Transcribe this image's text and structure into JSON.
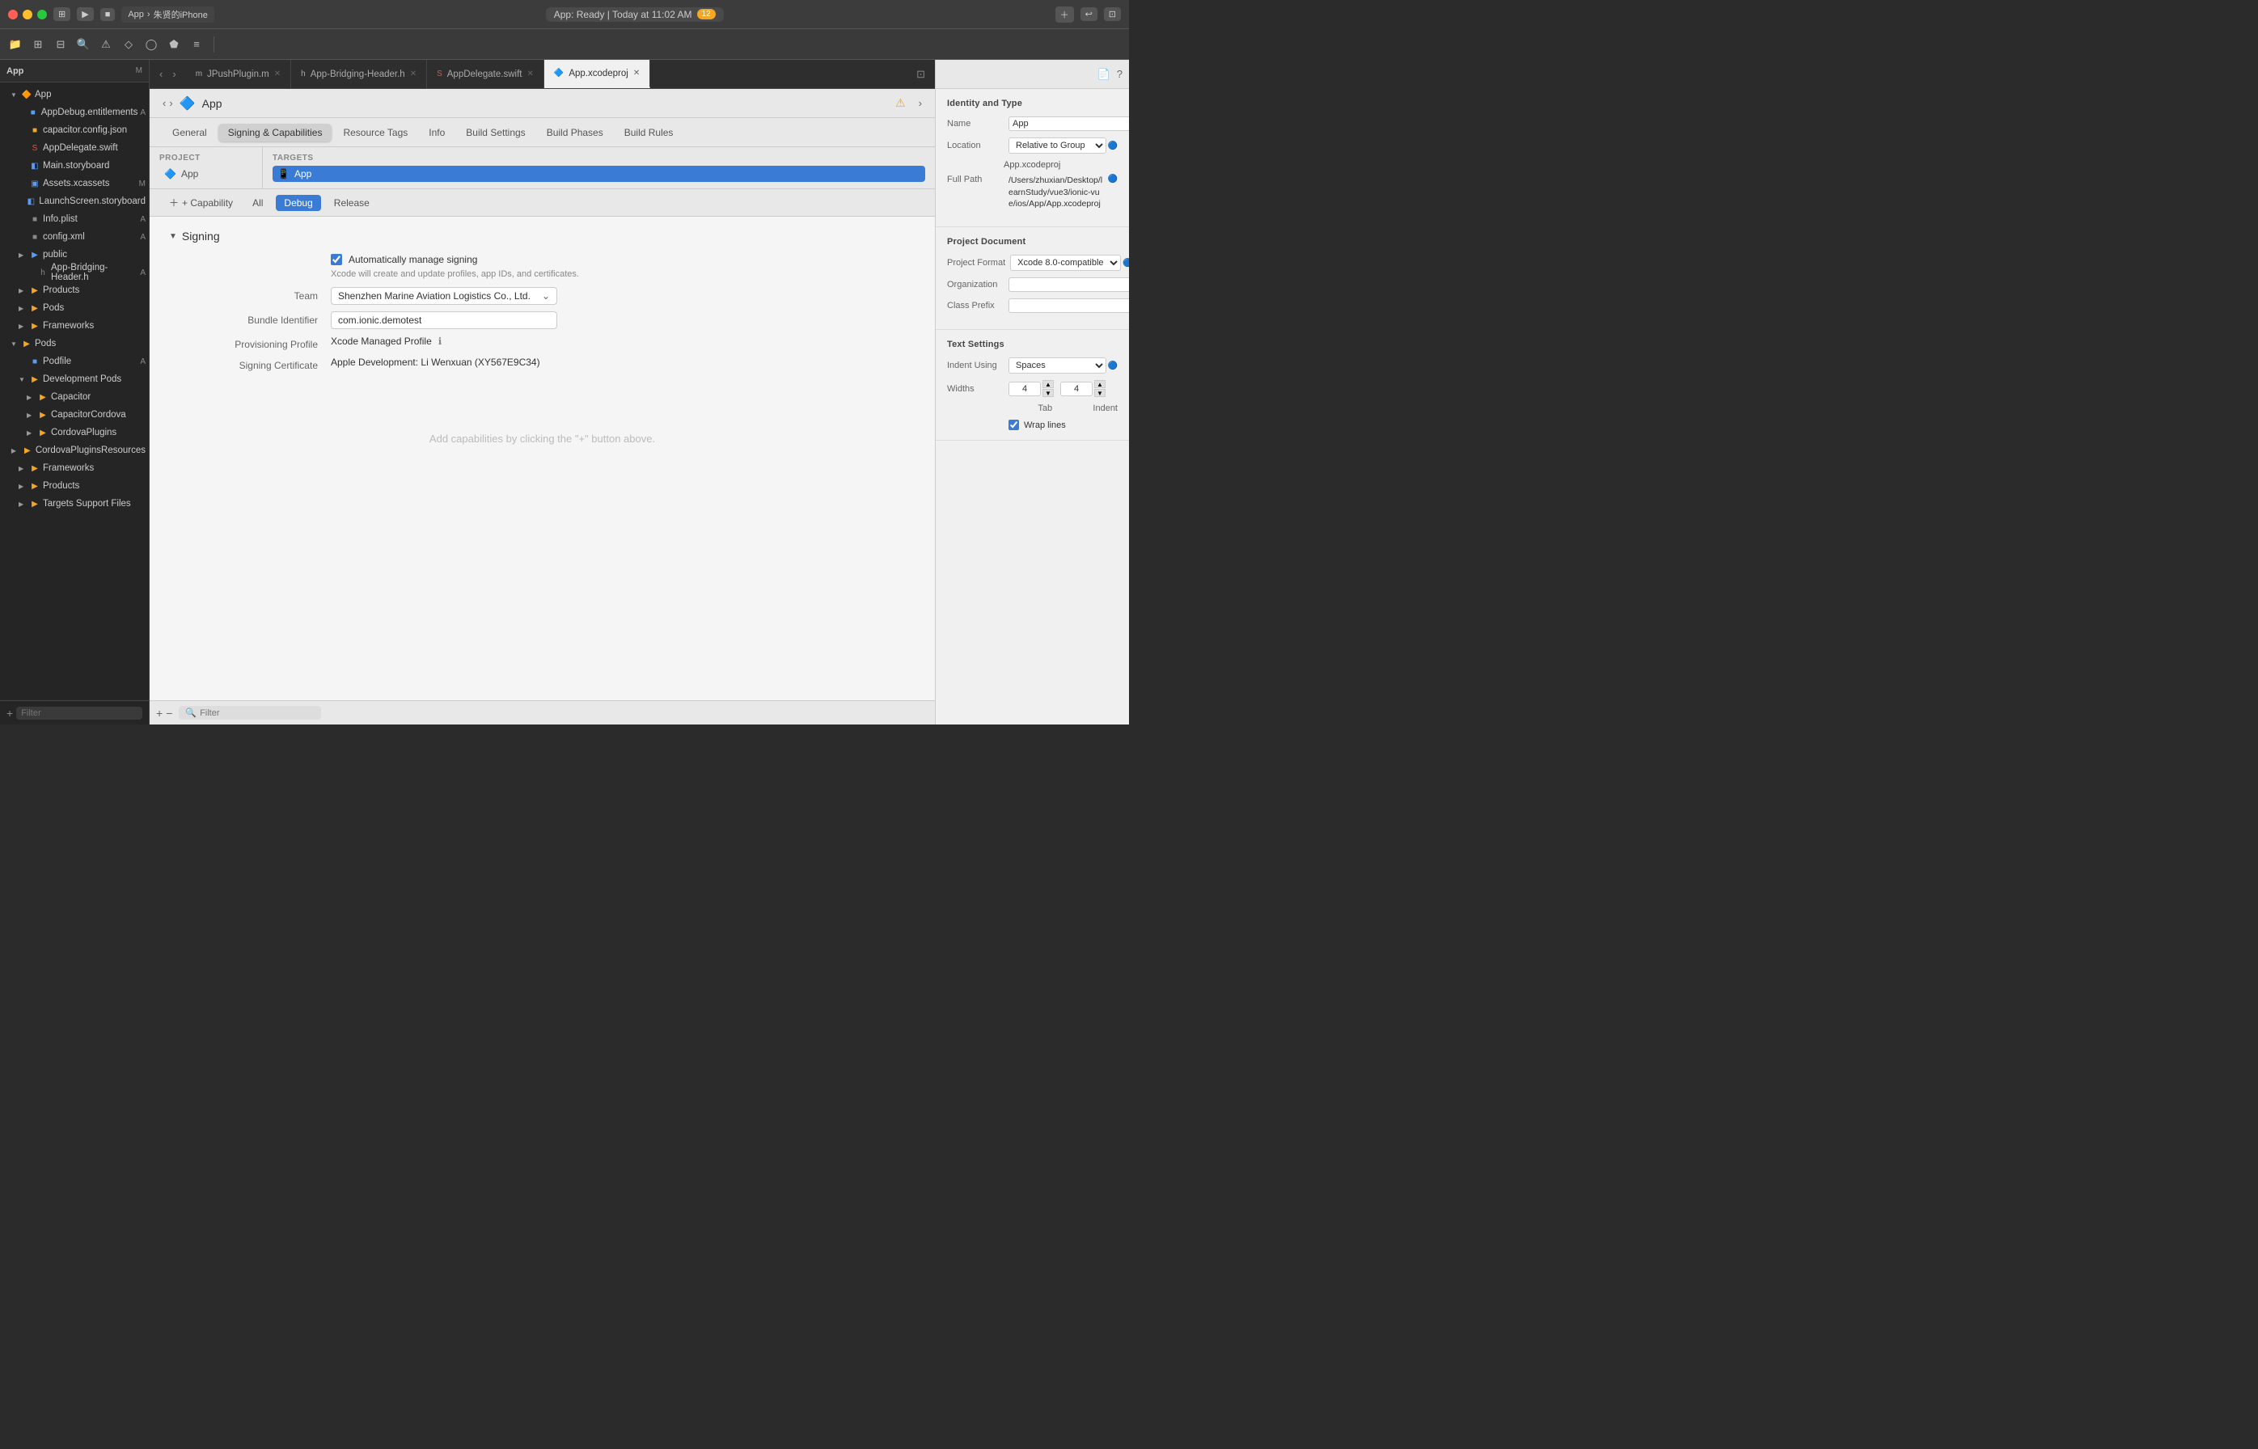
{
  "titleBar": {
    "appName": "App",
    "deviceName": "朱贤的iPhone",
    "statusText": "App: Ready | Today at 11:02 AM",
    "warningCount": "12",
    "runButton": "▶",
    "stopButton": "■"
  },
  "tabs": [
    {
      "id": "jpush",
      "icon": "m",
      "label": "JPushPlugin.m",
      "color": "#aaa",
      "active": false
    },
    {
      "id": "bridging",
      "icon": "h",
      "label": "App-Bridging-Header.h",
      "color": "#aaa",
      "active": false
    },
    {
      "id": "delegate",
      "icon": "swift",
      "label": "AppDelegate.swift",
      "color": "#f05138",
      "active": false
    },
    {
      "id": "xcodeproj",
      "icon": "proj",
      "label": "App.xcodeproj",
      "color": "#5b9cf6",
      "active": true
    }
  ],
  "projectHeader": {
    "icon": "🔷",
    "title": "App"
  },
  "settingsTabs": [
    {
      "label": "General",
      "active": false
    },
    {
      "label": "Signing & Capabilities",
      "active": true
    },
    {
      "label": "Resource Tags",
      "active": false
    },
    {
      "label": "Info",
      "active": false
    },
    {
      "label": "Build Settings",
      "active": false
    },
    {
      "label": "Build Phases",
      "active": false
    },
    {
      "label": "Build Rules",
      "active": false
    }
  ],
  "projectSection": {
    "title": "PROJECT",
    "items": [
      {
        "label": "App",
        "icon": "🔷",
        "selected": false
      }
    ]
  },
  "targetsSection": {
    "title": "TARGETS",
    "items": [
      {
        "label": "App",
        "icon": "📱",
        "selected": true
      }
    ]
  },
  "buildConfigs": {
    "addCapability": "+ Capability",
    "tabs": [
      {
        "label": "All",
        "active": false
      },
      {
        "label": "Debug",
        "active": true
      },
      {
        "label": "Release",
        "active": false
      }
    ]
  },
  "signing": {
    "sectionTitle": "Signing",
    "autoManage": {
      "label": "Automatically manage signing",
      "checked": true,
      "description": "Xcode will create and update profiles, app IDs, and certificates."
    },
    "team": {
      "label": "Team",
      "value": "Shenzhen Marine Aviation Logistics Co., Ltd."
    },
    "bundleId": {
      "label": "Bundle Identifier",
      "value": "com.ionic.demotest"
    },
    "provisioningProfile": {
      "label": "Provisioning Profile",
      "value": "Xcode Managed Profile"
    },
    "signingCertificate": {
      "label": "Signing Certificate",
      "value": "Apple Development: Li Wenxuan (XY567E9C34)"
    }
  },
  "capabilitiesPlaceholder": "Add capabilities by clicking the \"+\" button above.",
  "inspector": {
    "identityType": {
      "title": "Identity and Type",
      "name": {
        "label": "Name",
        "value": "App"
      },
      "location": {
        "label": "Location",
        "value": "Relative to Group"
      },
      "fileName": "App.xcodeproj",
      "fullPath": {
        "label": "Full Path",
        "value": "/Users/zhuxian/Desktop/learnStudy/vue3/ionic-vue/ios/App/App.xcodeproj"
      }
    },
    "projectDocument": {
      "title": "Project Document",
      "projectFormat": {
        "label": "Project Format",
        "value": "Xcode 8.0-compatible"
      },
      "organization": {
        "label": "Organization",
        "value": ""
      },
      "classPrefix": {
        "label": "Class Prefix",
        "value": ""
      }
    },
    "textSettings": {
      "title": "Text Settings",
      "indentUsing": {
        "label": "Indent Using",
        "value": "Spaces"
      },
      "widths": {
        "label": "Widths",
        "tab": "4",
        "indent": "4"
      },
      "tabLabel": "Tab",
      "indentLabel": "Indent",
      "wrapLines": {
        "label": "Wrap lines",
        "checked": true
      }
    }
  },
  "sidebar": {
    "rootLabel": "App",
    "badge": "M",
    "items": [
      {
        "id": "app-root",
        "level": 1,
        "label": "App",
        "type": "folder",
        "open": true,
        "badge": ""
      },
      {
        "id": "appdebug",
        "level": 2,
        "label": "AppDebug.entitlements",
        "type": "file",
        "icon": "doc",
        "badge": "A"
      },
      {
        "id": "capacitor-json",
        "level": 2,
        "label": "capacitor.config.json",
        "type": "file",
        "icon": "json",
        "badge": ""
      },
      {
        "id": "appdelegate",
        "level": 2,
        "label": "AppDelegate.swift",
        "type": "file",
        "icon": "swift",
        "badge": ""
      },
      {
        "id": "mainstoryboard",
        "level": 2,
        "label": "Main.storyboard",
        "type": "file",
        "icon": "storyboard",
        "badge": ""
      },
      {
        "id": "assets",
        "level": 2,
        "label": "Assets.xcassets",
        "type": "file",
        "icon": "assets",
        "badge": "M"
      },
      {
        "id": "launchscreen",
        "level": 2,
        "label": "LaunchScreen.storyboard",
        "type": "file",
        "icon": "storyboard",
        "badge": ""
      },
      {
        "id": "infoplist",
        "level": 2,
        "label": "Info.plist",
        "type": "file",
        "icon": "plist",
        "badge": "A"
      },
      {
        "id": "configxml",
        "level": 2,
        "label": "config.xml",
        "type": "file",
        "icon": "xml",
        "badge": "A"
      },
      {
        "id": "public",
        "level": 2,
        "label": "public",
        "type": "folder",
        "open": false,
        "badge": ""
      },
      {
        "id": "app-bridging",
        "level": 3,
        "label": "App-Bridging-Header.h",
        "type": "file",
        "icon": "header",
        "badge": "A"
      },
      {
        "id": "products-top",
        "level": 2,
        "label": "Products",
        "type": "folder",
        "open": false,
        "badge": ""
      },
      {
        "id": "pods",
        "level": 2,
        "label": "Pods",
        "type": "folder",
        "open": false,
        "badge": ""
      },
      {
        "id": "frameworks-top",
        "level": 2,
        "label": "Frameworks",
        "type": "folder",
        "open": false,
        "badge": ""
      },
      {
        "id": "pods-root",
        "level": 1,
        "label": "Pods",
        "type": "folder",
        "open": true,
        "badge": ""
      },
      {
        "id": "podfile",
        "level": 2,
        "label": "Podfile",
        "type": "file",
        "icon": "doc",
        "badge": "A"
      },
      {
        "id": "devpods",
        "level": 2,
        "label": "Development Pods",
        "type": "folder",
        "open": true,
        "badge": ""
      },
      {
        "id": "capacitor",
        "level": 3,
        "label": "Capacitor",
        "type": "folder",
        "open": false,
        "badge": ""
      },
      {
        "id": "capacitorcordova",
        "level": 3,
        "label": "CapacitorCordova",
        "type": "folder",
        "open": false,
        "badge": ""
      },
      {
        "id": "cordovaplugins",
        "level": 3,
        "label": "CordovaPlugins",
        "type": "folder",
        "open": false,
        "badge": ""
      },
      {
        "id": "cordovapluginsres",
        "level": 3,
        "label": "CordovaPluginsResources",
        "type": "folder",
        "open": false,
        "badge": ""
      },
      {
        "id": "frameworks-pods",
        "level": 2,
        "label": "Frameworks",
        "type": "folder",
        "open": false,
        "badge": ""
      },
      {
        "id": "products-pods",
        "level": 2,
        "label": "Products",
        "type": "folder",
        "open": false,
        "badge": ""
      },
      {
        "id": "targets-support",
        "level": 2,
        "label": "Targets Support Files",
        "type": "folder",
        "open": false,
        "badge": ""
      }
    ]
  },
  "sidebarFooter": {
    "addButton": "+",
    "filterPlaceholder": "Filter"
  },
  "editorFooter": {
    "addButton": "+",
    "removeButton": "−",
    "filterPlaceholder": "Filter"
  }
}
